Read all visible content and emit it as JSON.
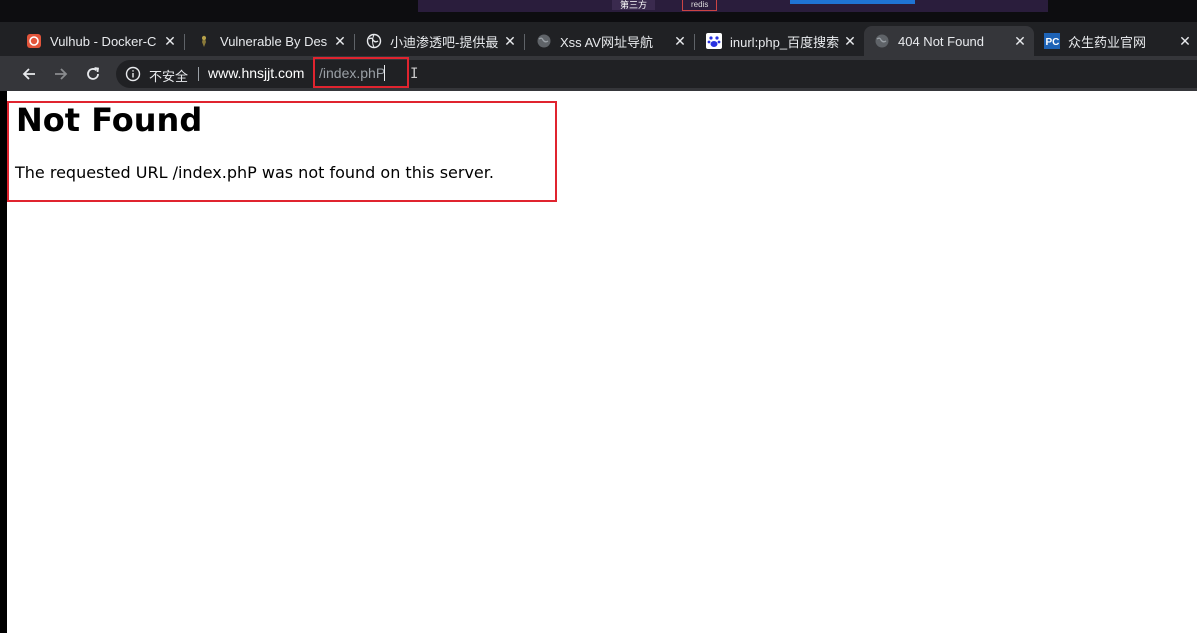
{
  "top_strip": {
    "tag_label": "第三方",
    "tag_label_2": "redis"
  },
  "tabs": [
    {
      "title": "Vulhub - Docker-C",
      "icon": "vulhub-icon",
      "active": false
    },
    {
      "title": "Vulnerable By Des",
      "icon": "vulnhub-icon",
      "active": false
    },
    {
      "title": "小迪渗透吧-提供最",
      "icon": "globe-icon",
      "active": false
    },
    {
      "title": "Xss AV网址导航",
      "icon": "globe-icon",
      "active": false
    },
    {
      "title": "inurl:php_百度搜索",
      "icon": "baidu-paw-icon",
      "active": false
    },
    {
      "title": "404 Not Found",
      "icon": "globe-icon",
      "active": true
    },
    {
      "title": "众生药业官网",
      "icon": "pc-logo-icon",
      "active": false
    }
  ],
  "toolbar": {
    "security_label": "不安全",
    "url_host": "www.hnsjjt.com",
    "url_path": "/index.phP"
  },
  "page": {
    "heading": "Not Found",
    "message": "The requested URL /index.phP was not found on this server."
  },
  "colors": {
    "annotation": "#e0242f",
    "tab_bar": "#202124",
    "toolbar": "#35363a"
  }
}
